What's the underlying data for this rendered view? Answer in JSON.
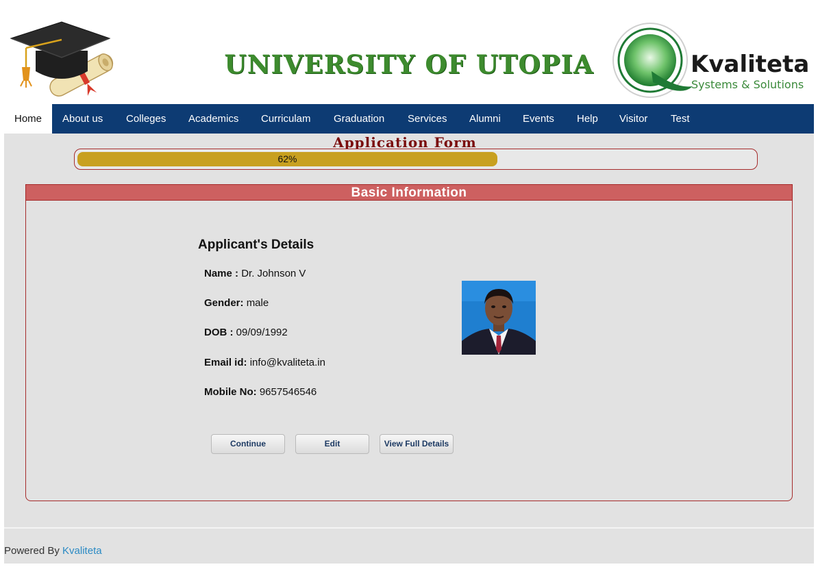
{
  "header": {
    "title": "UNIVERSITY OF UTOPIA",
    "brand_name": "Kvaliteta",
    "brand_tagline": "Systems & Solutions"
  },
  "nav": {
    "items": [
      {
        "label": "Home",
        "active": true
      },
      {
        "label": "About us",
        "active": false
      },
      {
        "label": "Colleges",
        "active": false
      },
      {
        "label": "Academics",
        "active": false
      },
      {
        "label": "Curriculam",
        "active": false
      },
      {
        "label": "Graduation",
        "active": false
      },
      {
        "label": "Services",
        "active": false
      },
      {
        "label": "Alumni",
        "active": false
      },
      {
        "label": "Events",
        "active": false
      },
      {
        "label": "Help",
        "active": false
      },
      {
        "label": "Visitor",
        "active": false
      },
      {
        "label": "Test",
        "active": false
      }
    ]
  },
  "form": {
    "title": "Application Form",
    "progress_percent": 62,
    "progress_label": "62%"
  },
  "panel": {
    "header": "Basic Information",
    "details_heading": "Applicant's Details",
    "fields": [
      {
        "label": "Name :",
        "value": "Dr. Johnson V"
      },
      {
        "label": "Gender:",
        "value": "male"
      },
      {
        "label": "DOB :",
        "value": "09/09/1992"
      },
      {
        "label": "Email id:",
        "value": "info@kvaliteta.in"
      },
      {
        "label": "Mobile No:",
        "value": "9657546546"
      }
    ]
  },
  "buttons": {
    "continue": "Continue",
    "edit": "Edit",
    "view_full": "View Full Details"
  },
  "footer": {
    "prefix": "Powered By",
    "link": "Kvaliteta"
  },
  "colors": {
    "nav_bg": "#0d3b73",
    "accent_red": "#a52a2a",
    "panel_header": "#cd6060",
    "progress_fill": "#c8a020",
    "title_green": "#3d8b2e"
  }
}
